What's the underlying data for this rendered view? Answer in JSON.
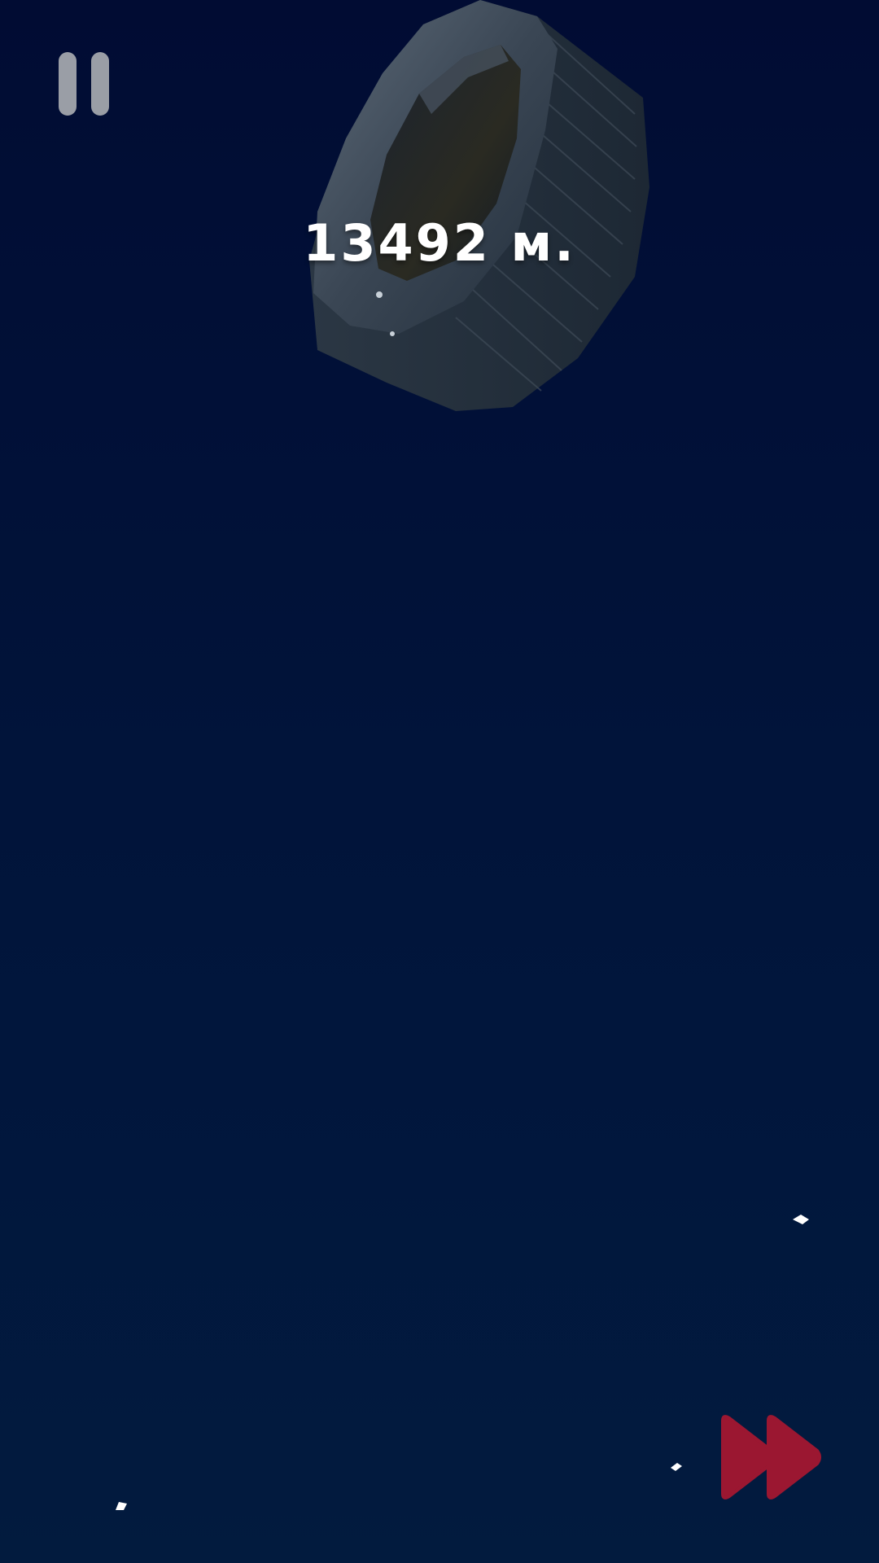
{
  "hud": {
    "distance_label": "13492 м.",
    "pause_icon": "pause-icon",
    "fast_forward_icon": "fast-forward-icon"
  },
  "colors": {
    "background_top": "#010c33",
    "background_bottom": "#021b3e",
    "pause_icon": "#9a9ea6",
    "fast_forward": "#9b1731",
    "distance_text": "#ffffff"
  }
}
